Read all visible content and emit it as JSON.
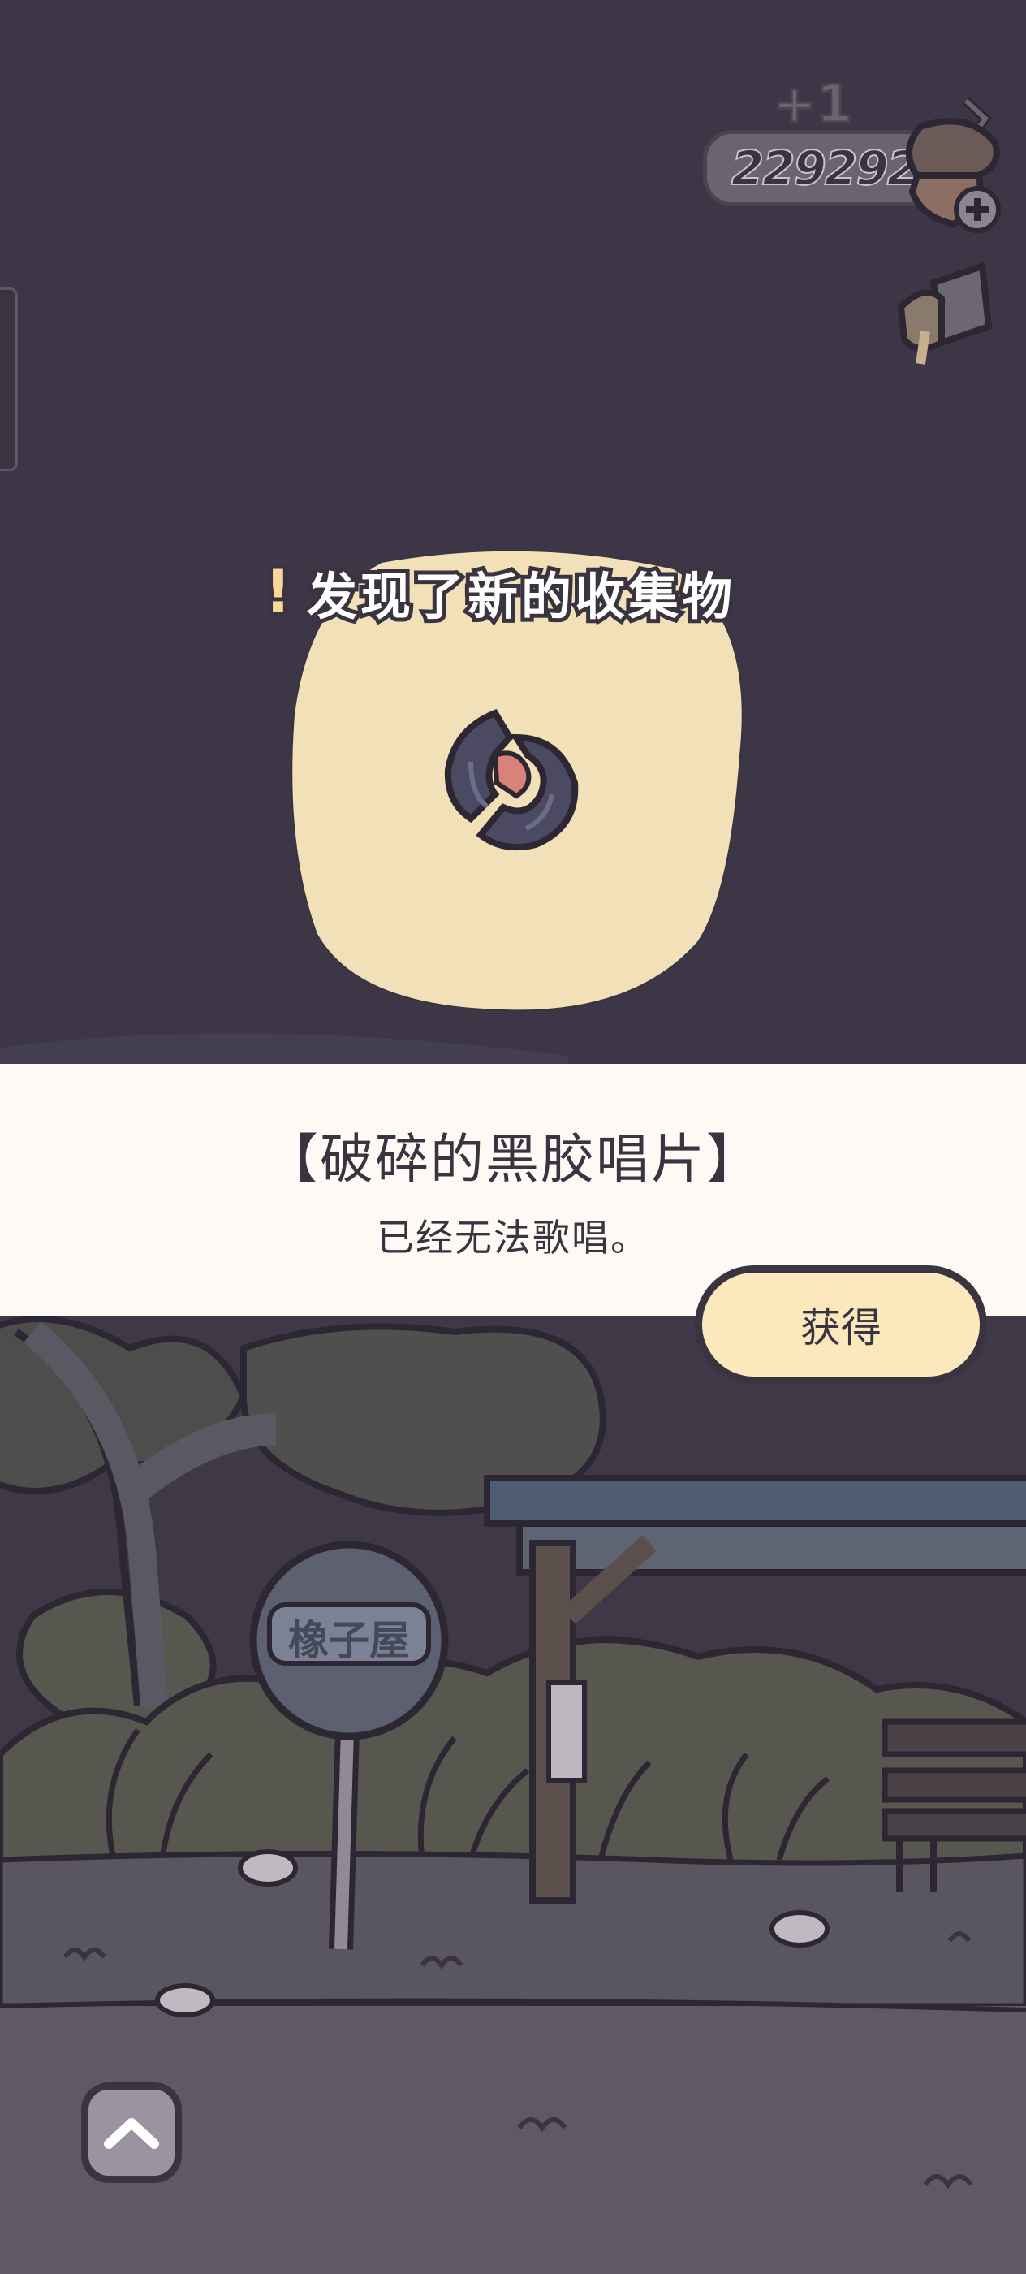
{
  "header": {
    "currency_amount": "229292",
    "currency_gain": "+1",
    "currency_icon": "acorn-icon",
    "add_currency_icon": "plus-icon",
    "side_icon": "flashlight-icon"
  },
  "discovery": {
    "title": "发现了新的收集物",
    "exclaim": "!",
    "item_icon": "broken-vinyl-record-icon"
  },
  "item": {
    "name": "【破碎的黑胶唱片】",
    "description": "已经无法歌唱。"
  },
  "actions": {
    "obtain_label": "获得",
    "expand_icon": "chevron-up-icon"
  },
  "scene": {
    "bus_sign_text": "橡子屋"
  },
  "colors": {
    "background": "#3d3647",
    "card": "#f1e0b8",
    "button": "#fbe9bd",
    "outline": "#3a3340",
    "info_band": "#fdfaf5"
  }
}
